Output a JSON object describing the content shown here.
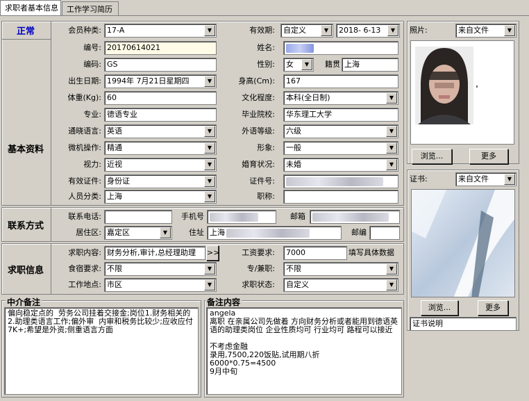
{
  "tabs": [
    "求职者基本信息",
    "工作学习简历"
  ],
  "status": "正常",
  "sections": {
    "basic": "基本资料",
    "contact": "联系方式",
    "job": "求职信息"
  },
  "basic": {
    "member_type_label": "会员种类:",
    "member_type": "17-A",
    "validity_label": "有效期:",
    "validity": "自定义",
    "validity_date": "2018- 6-13",
    "number_label": "编号:",
    "number": "20170614021",
    "name_label": "姓名:",
    "code_label": "编码:",
    "code": "GS",
    "gender_label": "性别:",
    "gender": "女",
    "origin_label": "籍贯",
    "origin": "上海",
    "birth_label": "出生日期:",
    "birth": "1994年 7月21日星期四",
    "height_label": "身高(Cm):",
    "height": "167",
    "weight_label": "体重(Kg):",
    "weight": "60",
    "education_label": "文化程度:",
    "education": "本科(全日制)",
    "major_label": "专业:",
    "major": "德语专业",
    "school_label": "毕业院校:",
    "school": "华东理工大学",
    "language_label": "通晓语言:",
    "language": "英语",
    "foreign_level_label": "外语等级:",
    "foreign_level": "六级",
    "computer_label": "微机操作:",
    "computer": "精通",
    "image_label": "形象:",
    "image": "一般",
    "vision_label": "视力:",
    "vision": "近视",
    "marital_label": "婚育状况:",
    "marital": "未婚",
    "id_type_label": "有效证件:",
    "id_type": "身份证",
    "id_number_label": "证件号:",
    "person_type_label": "人员分类:",
    "person_type": "上海",
    "title_label": "职称:"
  },
  "contact": {
    "phone_label": "联系电话:",
    "mobile_label": "手机号",
    "email_label": "邮箱",
    "district_label": "居住区:",
    "district": "嘉定区",
    "address_label": "住址",
    "address": "上海",
    "postcode_label": "邮编"
  },
  "job": {
    "content_label": "求职内容:",
    "content": "财务分析,审计,总经理助理",
    "more_btn": ">>",
    "salary_label": "工资要求:",
    "salary": "7000",
    "salary_hint": "填写具体数据",
    "housing_label": "食宿要求:",
    "housing": "不限",
    "fulltime_label": "专/兼职:",
    "fulltime": "不限",
    "location_label": "工作地点:",
    "location": "市区",
    "job_status_label": "求职状态:",
    "job_status": "自定义"
  },
  "photo": {
    "label": "照片:",
    "source": "来自文件",
    "browse": "浏览...",
    "more": "更多"
  },
  "cert": {
    "label": "证书:",
    "source": "来自文件",
    "browse": "浏览...",
    "more": "更多",
    "desc": "证书说明"
  },
  "agent_note": {
    "title": "中介备注",
    "text": "偏向稳定点的  劳务公司挂着交接金;岗位1.财务相关的  2.助理类语言工作;偏外审  内审和税务比较少;应收应付  7K+;希望是外资;侧重语言方面"
  },
  "remark": {
    "title": "备注内容",
    "text": "angela\n离职 在亲属公司先做着 方向财务分析或者能用到德语英语的助理类岗位 企业性质均可 行业均可 路程可以接近\n\n不考虑金融\n录用,7500,220饭贴,试用期八折\n6000*0.75=4500\n9月中旬"
  },
  "colors": {
    "status": "#0000c0",
    "bg": "#d4d0c8",
    "highlight": "#fffbe6"
  }
}
